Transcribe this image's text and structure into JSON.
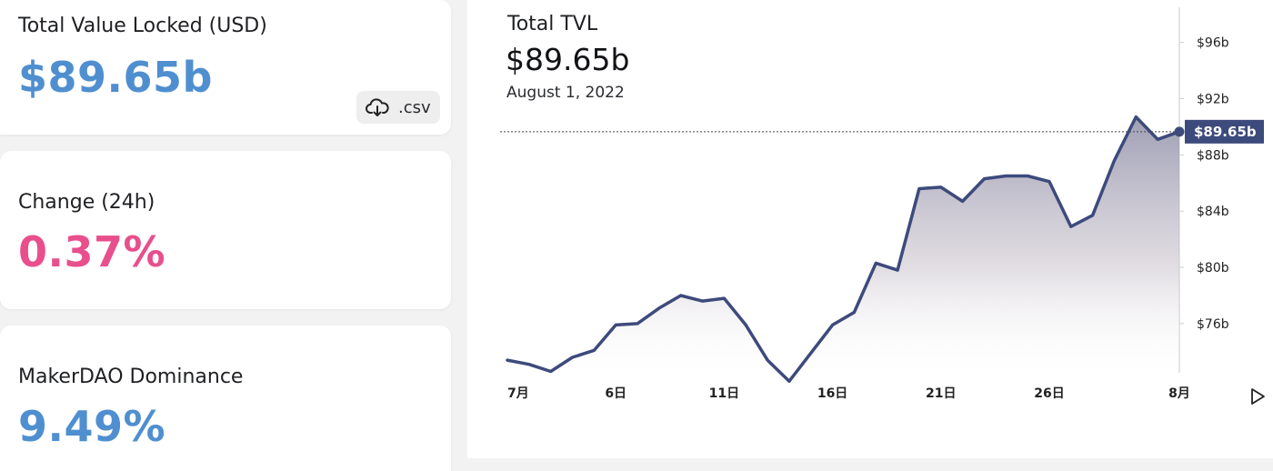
{
  "stats": {
    "tvl_label": "Total Value Locked (USD)",
    "tvl_value": "$89.65b",
    "csv_label": ".csv",
    "change_label": "Change (24h)",
    "change_value": "0.37%",
    "dominance_label": "MakerDAO Dominance",
    "dominance_value": "9.49%"
  },
  "colors": {
    "tvl_value": "#4f8fd0",
    "change_value": "#e84f8c",
    "dominance_value": "#4f8fd0",
    "line": "#3d4a7c",
    "tooltip_bg": "#3d4a7c"
  },
  "chart_data": {
    "type": "area",
    "title": "Total TVL",
    "current_value_text": "$89.65b",
    "current_date": "August 1, 2022",
    "tooltip_label": "$89.65b",
    "x_tick_labels": [
      {
        "day": 1,
        "label": "7月"
      },
      {
        "day": 6,
        "label": "6日"
      },
      {
        "day": 11,
        "label": "11日"
      },
      {
        "day": 16,
        "label": "16日"
      },
      {
        "day": 21,
        "label": "21日"
      },
      {
        "day": 26,
        "label": "26日"
      },
      {
        "day": 32,
        "label": "8月"
      }
    ],
    "y_tick_labels": [
      {
        "value": 76,
        "label": "$76b"
      },
      {
        "value": 80,
        "label": "$80b"
      },
      {
        "value": 84,
        "label": "$84b"
      },
      {
        "value": 88,
        "label": "$88b"
      },
      {
        "value": 92,
        "label": "$92b"
      },
      {
        "value": 96,
        "label": "$96b"
      }
    ],
    "ylim": [
      72.5,
      98.5
    ],
    "xlim": [
      1,
      32
    ],
    "series": [
      {
        "x": [
          1,
          2,
          3,
          4,
          5,
          6,
          7,
          8,
          9,
          10,
          11,
          12,
          13,
          14,
          15,
          16,
          17,
          18,
          19,
          20,
          21,
          22,
          23,
          24,
          25,
          26,
          27,
          28,
          29,
          30,
          31,
          32
        ],
        "values": [
          73.4,
          73.1,
          72.6,
          73.6,
          74.1,
          75.9,
          76.0,
          77.1,
          78.0,
          77.6,
          77.8,
          75.9,
          73.4,
          71.9,
          73.9,
          75.9,
          76.8,
          80.3,
          79.8,
          85.6,
          85.7,
          84.7,
          86.3,
          86.5,
          86.5,
          86.1,
          82.9,
          83.7,
          87.6,
          90.7,
          89.1,
          89.65
        ]
      }
    ]
  }
}
